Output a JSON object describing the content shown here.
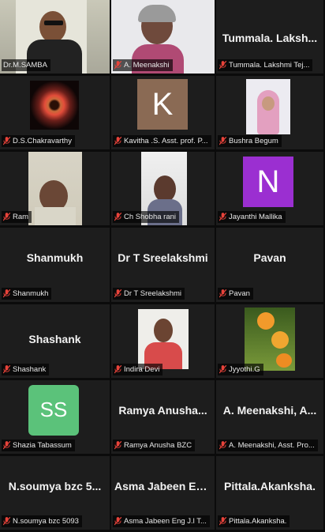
{
  "participants": [
    {
      "id": "p1",
      "label": "Dr.M.SAMBA"
    },
    {
      "id": "p2",
      "label": "A. Meenakshi"
    },
    {
      "id": "p3",
      "label": "Tummala. Lakshmi Tej...",
      "tile_name": "Tummala. Laksh..."
    },
    {
      "id": "p4",
      "label": "D.S.Chakravarthy"
    },
    {
      "id": "p5",
      "label": "Kavitha .S.  Asst. prof. P...",
      "avatar": "K"
    },
    {
      "id": "p6",
      "label": "Bushra Begum"
    },
    {
      "id": "p7",
      "label": "Ram"
    },
    {
      "id": "p8",
      "label": "Ch Shobha rani"
    },
    {
      "id": "p9",
      "label": "Jayanthi Mallika",
      "avatar": "N"
    },
    {
      "id": "p10",
      "label": "Shanmukh",
      "tile_name": "Shanmukh"
    },
    {
      "id": "p11",
      "label": "Dr T Sreelakshmi",
      "tile_name": "Dr T Sreelakshmi"
    },
    {
      "id": "p12",
      "label": "Pavan",
      "tile_name": "Pavan"
    },
    {
      "id": "p13",
      "label": "Shashank",
      "tile_name": "Shashank"
    },
    {
      "id": "p14",
      "label": "Indira Devi"
    },
    {
      "id": "p15",
      "label": "Jyyothi.G"
    },
    {
      "id": "p16",
      "label": "Shazia Tabassum",
      "avatar": "SS"
    },
    {
      "id": "p17",
      "label": "Ramya Anusha  BZC",
      "tile_name": "Ramya  Anusha..."
    },
    {
      "id": "p18",
      "label": "A. Meenakshi, Asst. Pro...",
      "tile_name": "A. Meenakshi, A..."
    },
    {
      "id": "p19",
      "label": "N.soumya bzc 5093",
      "tile_name": "N.soumya bzc 5..."
    },
    {
      "id": "p20",
      "label": "Asma Jabeen Eng J.l T...",
      "tile_name": "Asma Jabeen En..."
    },
    {
      "id": "p21",
      "label": "Pittala.Akanksha.",
      "tile_name": "Pittala.Akanksha."
    }
  ],
  "colors": {
    "muted_icon": "#e8433a",
    "active_speaker_border": "#d6ff3a",
    "avatar_k_bg": "#8a6a54",
    "avatar_n_bg": "#9b2fd1",
    "avatar_ss_bg": "#5bc27a"
  }
}
